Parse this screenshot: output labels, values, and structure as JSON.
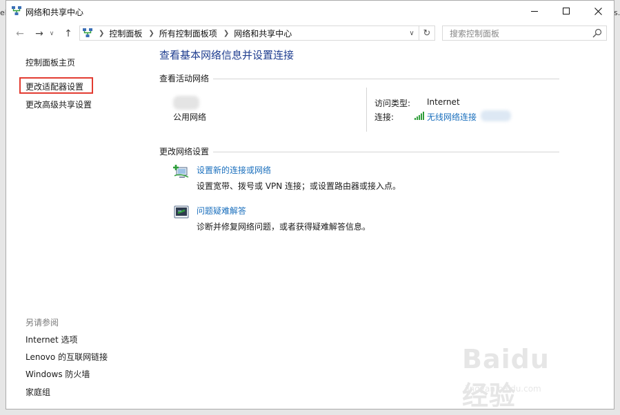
{
  "background": {
    "left_partial_text": "el",
    "right_partial_text": "s."
  },
  "window": {
    "title": "网络和共享中心",
    "controls": [
      "minimize",
      "maximize",
      "close"
    ]
  },
  "address_bar": {
    "breadcrumbs": [
      "控制面板",
      "所有控制面板项",
      "网络和共享中心"
    ],
    "search_placeholder": "搜索控制面板"
  },
  "left_pane": {
    "home_link": "控制面板主页",
    "adapter_link": "更改适配器设置",
    "sharing_link": "更改高级共享设置",
    "see_also_title": "另请参阅",
    "see_also": [
      "Internet 选项",
      "Lenovo 的互联网链接",
      "Windows 防火墙",
      "家庭组"
    ]
  },
  "main": {
    "title": "查看基本网络信息并设置连接",
    "active_networks_heading": "查看活动网络",
    "network_type": "公用网络",
    "access_type_label": "访问类型:",
    "access_type_value": "Internet",
    "connection_label": "连接:",
    "connection_link": "无线网络连接",
    "change_settings_heading": "更改网络设置",
    "tasks": [
      {
        "link": "设置新的连接或网络",
        "description": "设置宽带、拨号或 VPN 连接；或设置路由器或接入点。"
      },
      {
        "link": "问题疑难解答",
        "description": "诊断并修复网络问题，或者获得疑难解答信息。"
      }
    ]
  },
  "watermark": {
    "brand": "Baidu 经验",
    "url": "jingyan.baidu.com"
  },
  "colors": {
    "link": "#1a6fbd",
    "title": "#1e3d8f",
    "highlight": "#e23b30",
    "wifi": "#2e9e3a"
  }
}
